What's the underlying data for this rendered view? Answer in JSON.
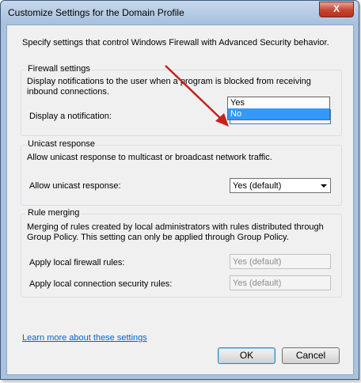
{
  "window": {
    "title": "Customize Settings for the Domain Profile",
    "close_glyph": "X"
  },
  "intro": "Specify settings that control Windows Firewall with Advanced Security behavior.",
  "firewall_settings": {
    "label": "Firewall settings",
    "description": "Display notifications to the user when a program is blocked from receiving inbound connections.",
    "notification_label": "Display a notification:",
    "notification_value": "Yes",
    "dropdown_options": [
      "Yes",
      "No"
    ],
    "highlighted_option": "No"
  },
  "unicast": {
    "label": "Unicast response",
    "description": "Allow unicast response to multicast or broadcast network traffic.",
    "field_label": "Allow unicast response:",
    "value": "Yes (default)"
  },
  "rule_merging": {
    "label": "Rule merging",
    "description": "Merging of rules created by local administrators with rules distributed through Group Policy. This setting can only be applied through Group Policy.",
    "firewall_rules_label": "Apply local firewall rules:",
    "firewall_rules_value": "Yes (default)",
    "security_rules_label": "Apply local connection security rules:",
    "security_rules_value": "Yes (default)"
  },
  "link": "Learn more about these settings",
  "buttons": {
    "ok": "OK",
    "cancel": "Cancel"
  },
  "colors": {
    "arrow": "#c8201e",
    "selection": "#3399ff",
    "link": "#0066cc"
  }
}
